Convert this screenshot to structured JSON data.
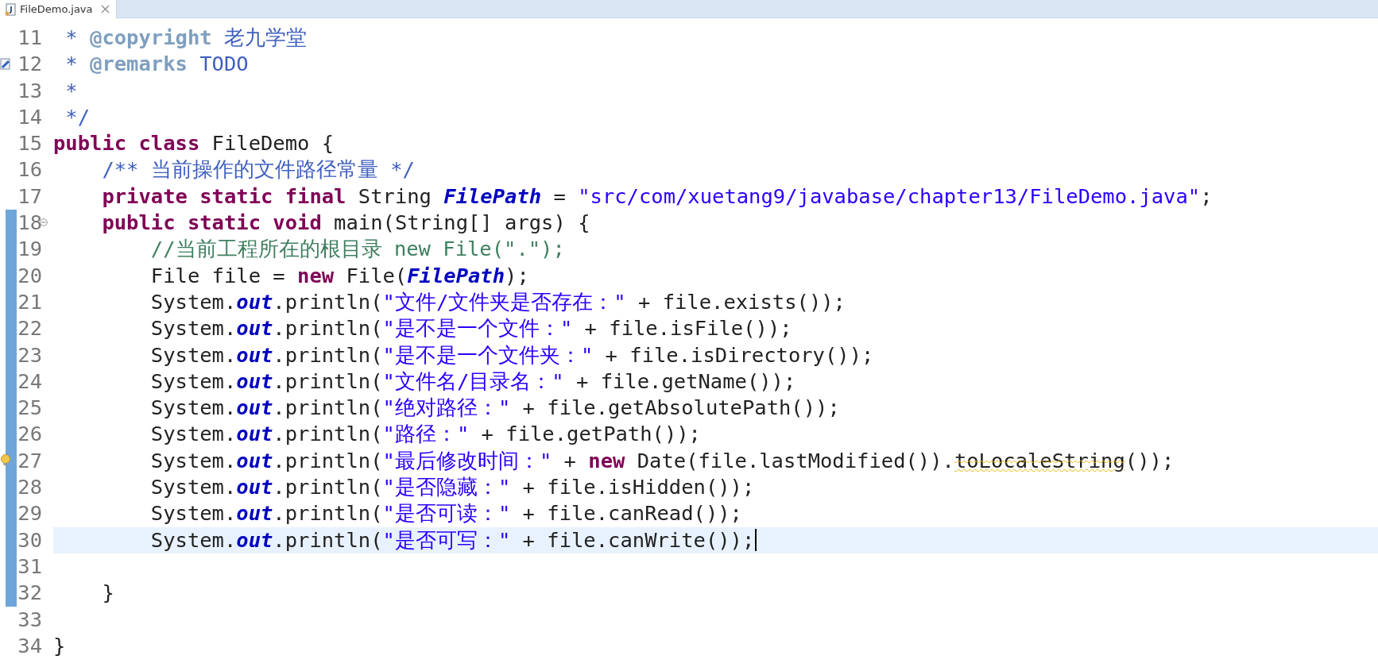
{
  "tab": {
    "title": "FileDemo.java",
    "selected": true
  },
  "lines": [
    {
      "number": "11",
      "kind": "plain",
      "changed": false,
      "current": false,
      "tokens": [
        {
          "kind": "javadoc",
          "text": " * "
        },
        {
          "kind": "doctag",
          "text": "@copyright"
        },
        {
          "kind": "javadoc",
          "text": " 老九学堂"
        }
      ]
    },
    {
      "number": "12",
      "kind": "task",
      "changed": false,
      "current": false,
      "tokens": [
        {
          "kind": "javadoc",
          "text": " * "
        },
        {
          "kind": "doctag",
          "text": "@remarks"
        },
        {
          "kind": "javadoc",
          "text": " TODO"
        }
      ]
    },
    {
      "number": "13",
      "kind": "plain",
      "changed": false,
      "current": false,
      "tokens": [
        {
          "kind": "javadoc",
          "text": " *"
        }
      ]
    },
    {
      "number": "14",
      "kind": "plain",
      "changed": false,
      "current": false,
      "tokens": [
        {
          "kind": "javadoc",
          "text": " */"
        }
      ]
    },
    {
      "number": "15",
      "kind": "plain",
      "changed": false,
      "current": false,
      "tokens": [
        {
          "kind": "keyword",
          "text": "public class"
        },
        {
          "kind": "plain",
          "text": " FileDemo {"
        }
      ]
    },
    {
      "number": "16",
      "kind": "plain",
      "changed": false,
      "current": false,
      "tokens": [
        {
          "kind": "javadoc",
          "text": "    /** 当前操作的文件路径常量 */"
        }
      ]
    },
    {
      "number": "17",
      "kind": "plain",
      "changed": false,
      "current": false,
      "tokens": [
        {
          "kind": "keyword",
          "text": "    private static final"
        },
        {
          "kind": "plain",
          "text": " String "
        },
        {
          "kind": "field",
          "text": "FilePath"
        },
        {
          "kind": "plain",
          "text": " = "
        },
        {
          "kind": "string",
          "text": "\"src/com/xuetang9/javabase/chapter13/FileDemo.java\""
        },
        {
          "kind": "plain",
          "text": ";"
        }
      ]
    },
    {
      "number": "18",
      "kind": "fold",
      "changed": true,
      "current": false,
      "tokens": [
        {
          "kind": "keyword",
          "text": "    public static void"
        },
        {
          "kind": "plain",
          "text": " main(String[] args) {"
        }
      ]
    },
    {
      "number": "19",
      "kind": "plain",
      "changed": true,
      "current": false,
      "tokens": [
        {
          "kind": "comment",
          "text": "        //当前工程所在的根目录 new File(\".\");"
        }
      ]
    },
    {
      "number": "20",
      "kind": "plain",
      "changed": true,
      "current": false,
      "tokens": [
        {
          "kind": "plain",
          "text": "        File file = "
        },
        {
          "kind": "keyword",
          "text": "new"
        },
        {
          "kind": "plain",
          "text": " File("
        },
        {
          "kind": "field",
          "text": "FilePath"
        },
        {
          "kind": "plain",
          "text": ");"
        }
      ]
    },
    {
      "number": "21",
      "kind": "plain",
      "changed": true,
      "current": false,
      "tokens": [
        {
          "kind": "plain",
          "text": "        System."
        },
        {
          "kind": "field",
          "text": "out"
        },
        {
          "kind": "plain",
          "text": ".println("
        },
        {
          "kind": "string",
          "text": "\"文件/文件夹是否存在：\""
        },
        {
          "kind": "plain",
          "text": " + file.exists());"
        }
      ]
    },
    {
      "number": "22",
      "kind": "plain",
      "changed": true,
      "current": false,
      "tokens": [
        {
          "kind": "plain",
          "text": "        System."
        },
        {
          "kind": "field",
          "text": "out"
        },
        {
          "kind": "plain",
          "text": ".println("
        },
        {
          "kind": "string",
          "text": "\"是不是一个文件：\""
        },
        {
          "kind": "plain",
          "text": " + file.isFile());"
        }
      ]
    },
    {
      "number": "23",
      "kind": "plain",
      "changed": true,
      "current": false,
      "tokens": [
        {
          "kind": "plain",
          "text": "        System."
        },
        {
          "kind": "field",
          "text": "out"
        },
        {
          "kind": "plain",
          "text": ".println("
        },
        {
          "kind": "string",
          "text": "\"是不是一个文件夹：\""
        },
        {
          "kind": "plain",
          "text": " + file.isDirectory());"
        }
      ]
    },
    {
      "number": "24",
      "kind": "plain",
      "changed": true,
      "current": false,
      "tokens": [
        {
          "kind": "plain",
          "text": "        System."
        },
        {
          "kind": "field",
          "text": "out"
        },
        {
          "kind": "plain",
          "text": ".println("
        },
        {
          "kind": "string",
          "text": "\"文件名/目录名：\""
        },
        {
          "kind": "plain",
          "text": " + file.getName());"
        }
      ]
    },
    {
      "number": "25",
      "kind": "plain",
      "changed": true,
      "current": false,
      "tokens": [
        {
          "kind": "plain",
          "text": "        System."
        },
        {
          "kind": "field",
          "text": "out"
        },
        {
          "kind": "plain",
          "text": ".println("
        },
        {
          "kind": "string",
          "text": "\"绝对路径：\""
        },
        {
          "kind": "plain",
          "text": " + file.getAbsolutePath());"
        }
      ]
    },
    {
      "number": "26",
      "kind": "plain",
      "changed": true,
      "current": false,
      "tokens": [
        {
          "kind": "plain",
          "text": "        System."
        },
        {
          "kind": "field",
          "text": "out"
        },
        {
          "kind": "plain",
          "text": ".println("
        },
        {
          "kind": "string",
          "text": "\"路径：\""
        },
        {
          "kind": "plain",
          "text": " + file.getPath());"
        }
      ]
    },
    {
      "number": "27",
      "kind": "warning",
      "changed": true,
      "current": false,
      "tokens": [
        {
          "kind": "plain",
          "text": "        System."
        },
        {
          "kind": "field",
          "text": "out"
        },
        {
          "kind": "plain",
          "text": ".println("
        },
        {
          "kind": "string",
          "text": "\"最后修改时间：\""
        },
        {
          "kind": "plain",
          "text": " + "
        },
        {
          "kind": "keyword",
          "text": "new"
        },
        {
          "kind": "plain",
          "text": " Date(file.lastModified())."
        },
        {
          "kind": "deprecated",
          "text": "toLocaleString"
        },
        {
          "kind": "plain",
          "text": "());"
        }
      ]
    },
    {
      "number": "28",
      "kind": "plain",
      "changed": true,
      "current": false,
      "tokens": [
        {
          "kind": "plain",
          "text": "        System."
        },
        {
          "kind": "field",
          "text": "out"
        },
        {
          "kind": "plain",
          "text": ".println("
        },
        {
          "kind": "string",
          "text": "\"是否隐藏：\""
        },
        {
          "kind": "plain",
          "text": " + file.isHidden());"
        }
      ]
    },
    {
      "number": "29",
      "kind": "plain",
      "changed": true,
      "current": false,
      "tokens": [
        {
          "kind": "plain",
          "text": "        System."
        },
        {
          "kind": "field",
          "text": "out"
        },
        {
          "kind": "plain",
          "text": ".println("
        },
        {
          "kind": "string",
          "text": "\"是否可读：\""
        },
        {
          "kind": "plain",
          "text": " + file.canRead());"
        }
      ]
    },
    {
      "number": "30",
      "kind": "plain",
      "changed": true,
      "current": true,
      "tokens": [
        {
          "kind": "plain",
          "text": "        System."
        },
        {
          "kind": "field",
          "text": "out"
        },
        {
          "kind": "plain",
          "text": ".println("
        },
        {
          "kind": "string",
          "text": "\"是否可写：\""
        },
        {
          "kind": "plain",
          "text": " + file.canWrite());"
        }
      ]
    },
    {
      "number": "31",
      "kind": "plain",
      "changed": true,
      "current": false
    },
    {
      "number": "32",
      "kind": "plain",
      "changed": true,
      "current": false,
      "tokens": [
        {
          "kind": "plain",
          "text": "    }"
        }
      ]
    },
    {
      "number": "33",
      "kind": "plain",
      "changed": false,
      "current": false
    },
    {
      "number": "34",
      "kind": "plain",
      "changed": false,
      "current": false,
      "tokens": [
        {
          "kind": "plain",
          "text": "}"
        }
      ]
    }
  ]
}
